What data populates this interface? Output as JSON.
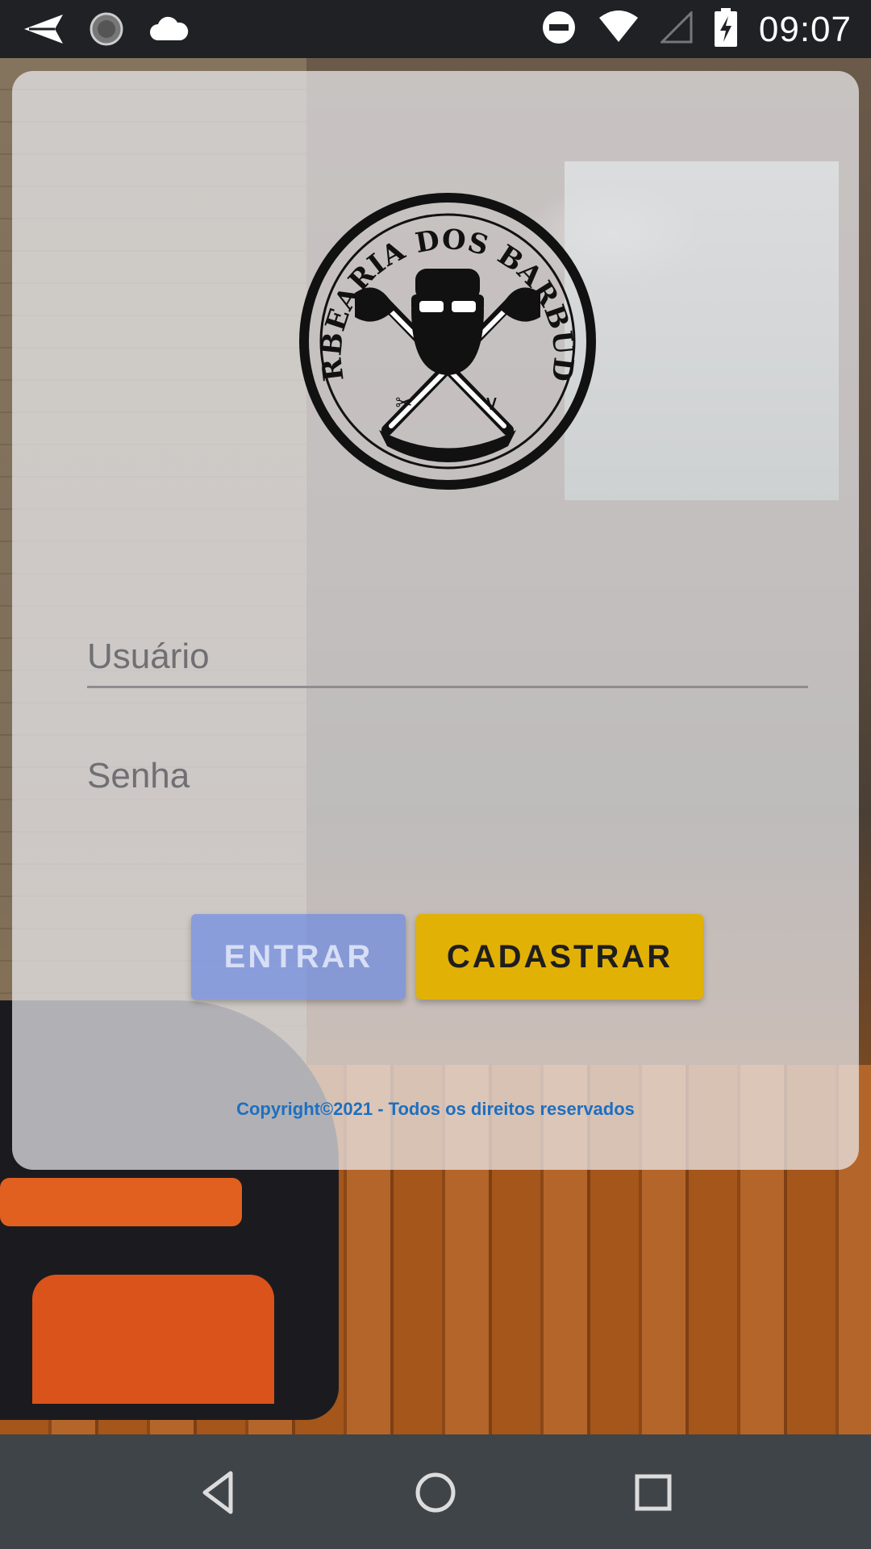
{
  "status_bar": {
    "time": "09:07",
    "left_icons": [
      "send-icon",
      "loading-icon",
      "cloud-icon"
    ],
    "right_icons": [
      "do-not-disturb-icon",
      "wifi-icon",
      "signal-icon",
      "battery-charging-icon"
    ]
  },
  "login": {
    "logo_text": "BARBEARIA DOS BARBUDOS",
    "username_placeholder": "Usuário",
    "password_placeholder": "Senha",
    "enter_label": "ENTRAR",
    "register_label": "CADASTRAR",
    "copyright": "Copyright©2021 - Todos os direitos reservados"
  },
  "colors": {
    "card_bg": "#ececf0",
    "enter_button": "#5f82e6",
    "register_button": "#e2b105",
    "copyright_text": "#1e6fc0"
  },
  "nav_bar": {
    "buttons": [
      "back-icon",
      "home-icon",
      "recents-icon"
    ]
  }
}
